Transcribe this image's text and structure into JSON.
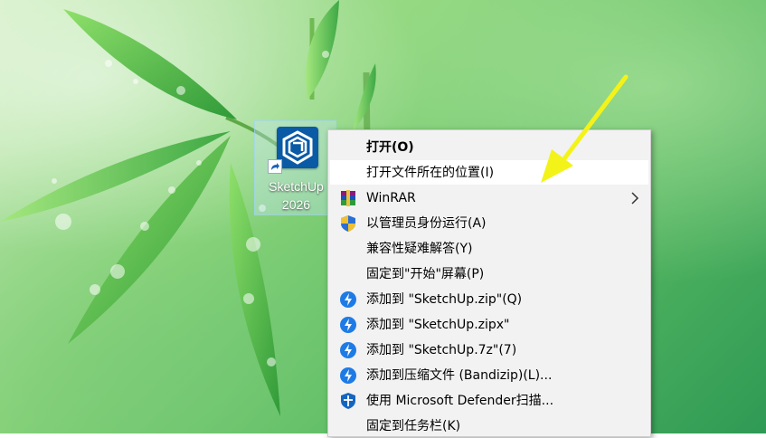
{
  "desktop": {
    "icon": {
      "label_line1": "SketchUp",
      "label_line2": "2026"
    }
  },
  "context_menu": {
    "items": [
      {
        "label": "打开(O)",
        "icon": "none",
        "bold": true
      },
      {
        "label": "打开文件所在的位置(I)",
        "icon": "none",
        "highlighted": true
      },
      {
        "label": "WinRAR",
        "icon": "winrar-icon",
        "submenu": true
      },
      {
        "label": "以管理员身份运行(A)",
        "icon": "uac-shield-icon"
      },
      {
        "label": "兼容性疑难解答(Y)",
        "icon": "none"
      },
      {
        "label": "固定到\"开始\"屏幕(P)",
        "icon": "none"
      },
      {
        "label": "添加到 \"SketchUp.zip\"(Q)",
        "icon": "bandizip-icon"
      },
      {
        "label": "添加到 \"SketchUp.zipx\"",
        "icon": "bandizip-icon"
      },
      {
        "label": "添加到 \"SketchUp.7z\"(7)",
        "icon": "bandizip-icon"
      },
      {
        "label": "添加到压缩文件 (Bandizip)(L)...",
        "icon": "bandizip-icon"
      },
      {
        "label": "使用 Microsoft Defender扫描...",
        "icon": "defender-icon"
      },
      {
        "label": "固定到任务栏(K)",
        "icon": "none"
      }
    ]
  },
  "annotation": {
    "color": "#f3f31a",
    "icon": "yellow-arrow"
  },
  "colors": {
    "menu_bg": "#f2f2f2",
    "highlight": "#ffffff",
    "bandizip": "#1e7be6"
  }
}
